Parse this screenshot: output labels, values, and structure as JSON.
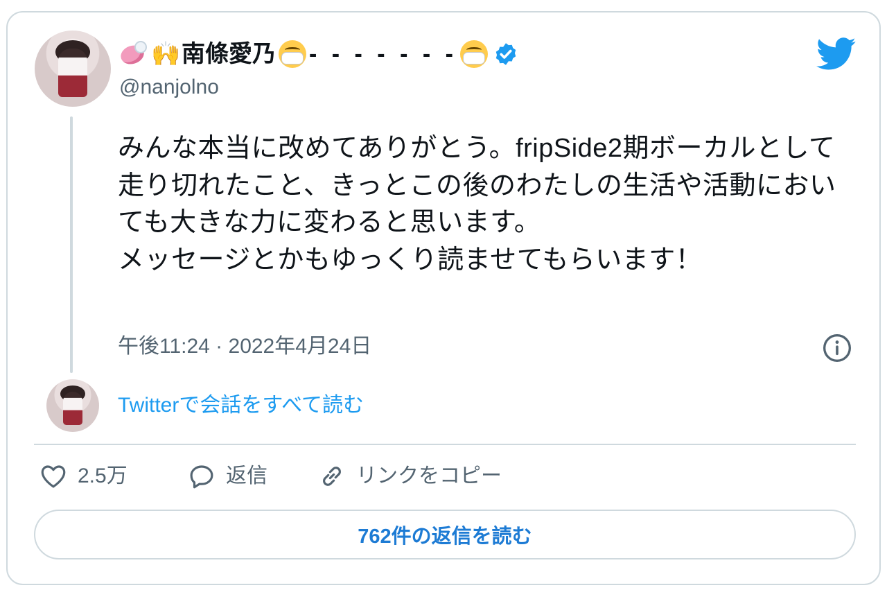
{
  "user": {
    "display_name": "南條愛乃",
    "dashes": "- - - - - - -",
    "handle": "@nanjolno",
    "icons": [
      "soap-icon",
      "raising-hands-icon",
      "mask-face-icon",
      "verified-badge-icon"
    ]
  },
  "tweet": {
    "text": "みんな本当に改めてありがとう。fripSide2期ボーカルとして走り切れたこと、きっとこの後のわたしの生活や活動においても大きな力に変わると思います。\nメッセージとかもゆっくり読ませてもらいます！",
    "timestamp": "午後11:24 · 2022年4月24日"
  },
  "links": {
    "read_conversation": "Twitterで会話をすべて読む"
  },
  "actions": {
    "like_count": "2.5万",
    "reply_label": "返信",
    "copy_link_label": "リンクをコピー"
  },
  "footer": {
    "read_replies": "762件の返信を読む"
  },
  "colors": {
    "twitter_blue": "#1d9bf0",
    "secondary_text": "#536471",
    "border": "#cfd9de"
  }
}
